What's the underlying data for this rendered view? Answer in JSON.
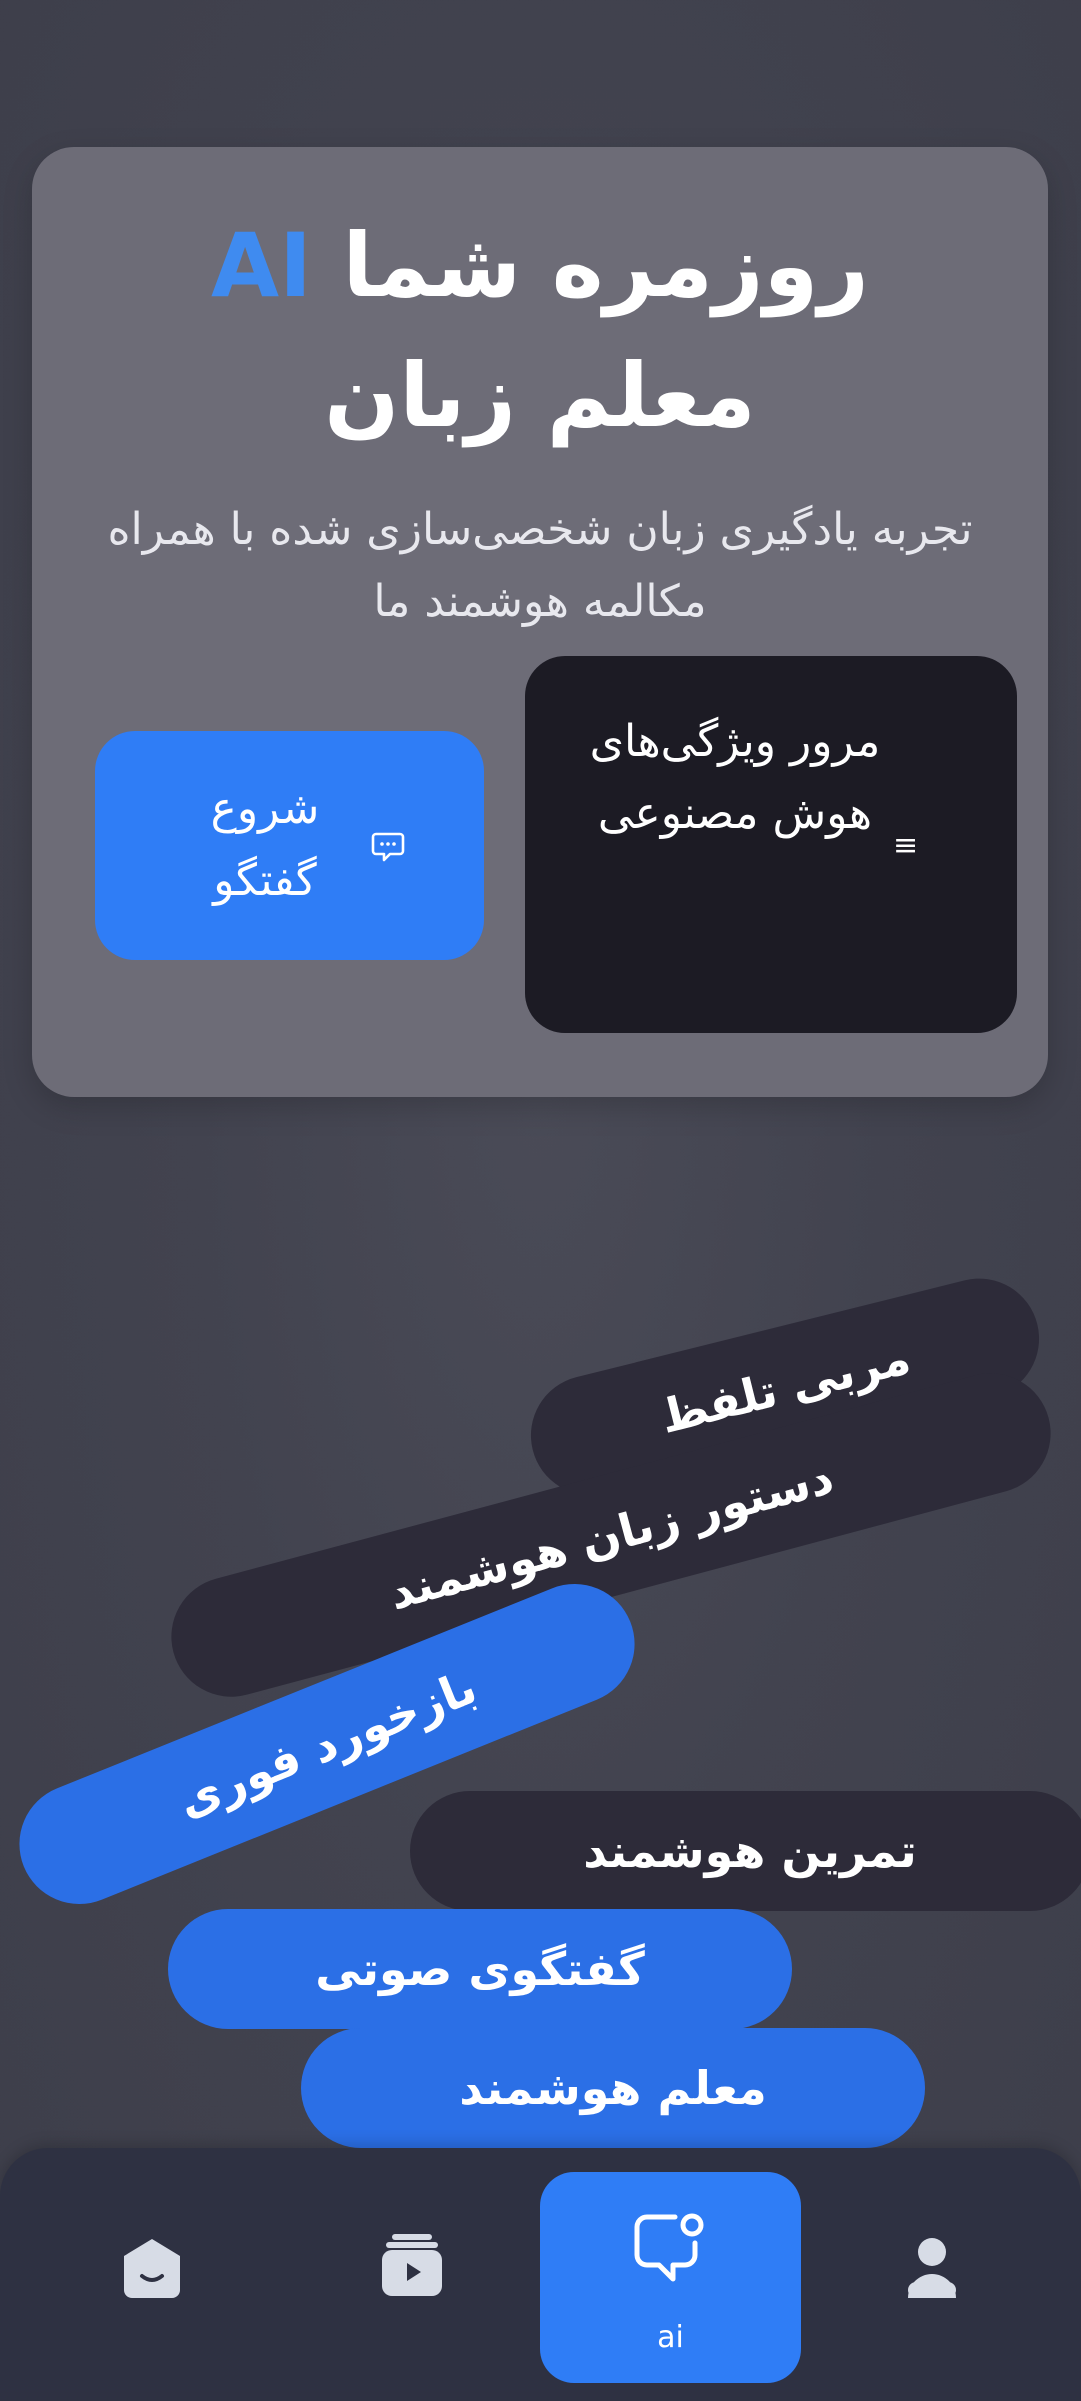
{
  "hero": {
    "title_line1_main": "روزمره شما",
    "title_line1_accent": "AI",
    "title_line2": "معلم زبان",
    "subtitle": "تجربه یادگیری زبان شخصی‌سازی شده با همراه مکالمه هوشمند ما",
    "accent_color": "#3f8bf0"
  },
  "buttons": {
    "features_label": "مرور ویژگی‌های هوش مصنوعی",
    "features_icon": "menu-icon",
    "start_label": "شروع گفتگو",
    "start_icon": "chat-bubble-icon"
  },
  "feature_pills": [
    {
      "label": "مربی تلفظ",
      "style": "dark"
    },
    {
      "label": "دستور زبان هوشمند",
      "style": "dark"
    },
    {
      "label": "بازخورد فوری",
      "style": "blue"
    },
    {
      "label": "تمرین هوشمند",
      "style": "dark"
    },
    {
      "label": "گفتگوی صوتی",
      "style": "blue"
    },
    {
      "label": "معلم هوشمند",
      "style": "blue"
    }
  ],
  "nav": {
    "items": [
      {
        "icon": "home-icon",
        "label": ""
      },
      {
        "icon": "video-library-icon",
        "label": ""
      },
      {
        "icon": "ai-chat-icon",
        "label": "ai",
        "active": true
      },
      {
        "icon": "profile-icon",
        "label": ""
      }
    ]
  },
  "colors": {
    "primary": "#2f7df6",
    "pill_dark": "#2d2b39",
    "card": "#6d6c77",
    "navbar": "#2e3142"
  }
}
